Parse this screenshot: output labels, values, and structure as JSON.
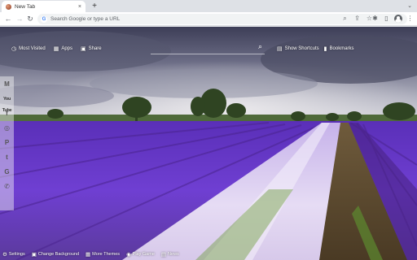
{
  "browser": {
    "tab_title": "New Tab",
    "tab_close": "×",
    "new_tab": "+",
    "tab_search": "⌄",
    "omnibox_placeholder": "Search Google or type a URL",
    "google_glyph": "G"
  },
  "toolbar_icons": {
    "back": "←",
    "forward": "→",
    "reload": "↻",
    "lens": "⌕",
    "share": "⇪",
    "star": "☆",
    "extensions": "✱",
    "sidepanel": "▯",
    "menu": "⋮"
  },
  "nav": {
    "most_visited": "Most Visited",
    "apps": "Apps",
    "share": "Share",
    "show_shortcuts": "Show Shortcuts",
    "bookmarks": "Bookmarks"
  },
  "search": {
    "placeholder": ""
  },
  "rail": {
    "gmail": "M",
    "youtube": "You Tube",
    "facebook": "f",
    "instagram": "◎",
    "pinterest": "P",
    "twitter": "t",
    "google": "G",
    "whatsapp": "✆"
  },
  "bottom": {
    "settings": "Settings",
    "change_bg": "Change Background",
    "more_themes": "More Themes",
    "play_game": "Play Game",
    "news": "News"
  },
  "colors": {
    "chrome_bg": "#dee1e6",
    "sky_top": "#3e3f57",
    "lavender": "#7a4fd0"
  }
}
